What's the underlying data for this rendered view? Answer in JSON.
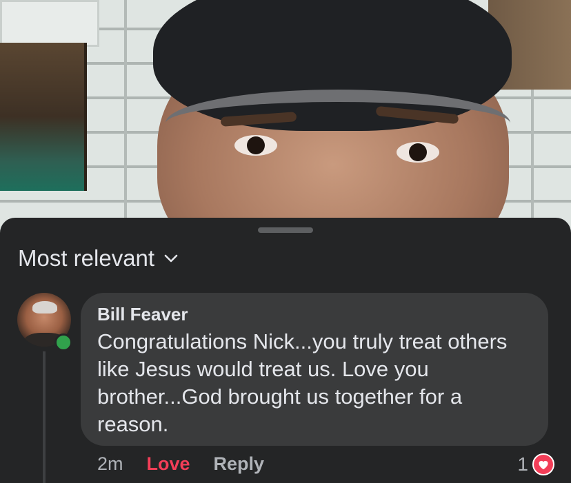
{
  "sort": {
    "label": "Most relevant",
    "icon": "chevron-down-icon"
  },
  "comment": {
    "author": "Bill Feaver",
    "text": "Congratulations Nick...you truly treat others like Jesus would treat us. Love you brother...God brought us together for a reason.",
    "time": "2m",
    "love_label": "Love",
    "reply_label": "Reply",
    "reaction_count": "1",
    "reaction_icon": "heart-icon",
    "online": true
  },
  "colors": {
    "sheet_background": "#242526",
    "bubble_background": "#3a3b3c",
    "love_accent": "#f33e58",
    "online_green": "#31a24c",
    "primary_text": "#e4e6eb",
    "secondary_text": "#b0b3b8"
  }
}
